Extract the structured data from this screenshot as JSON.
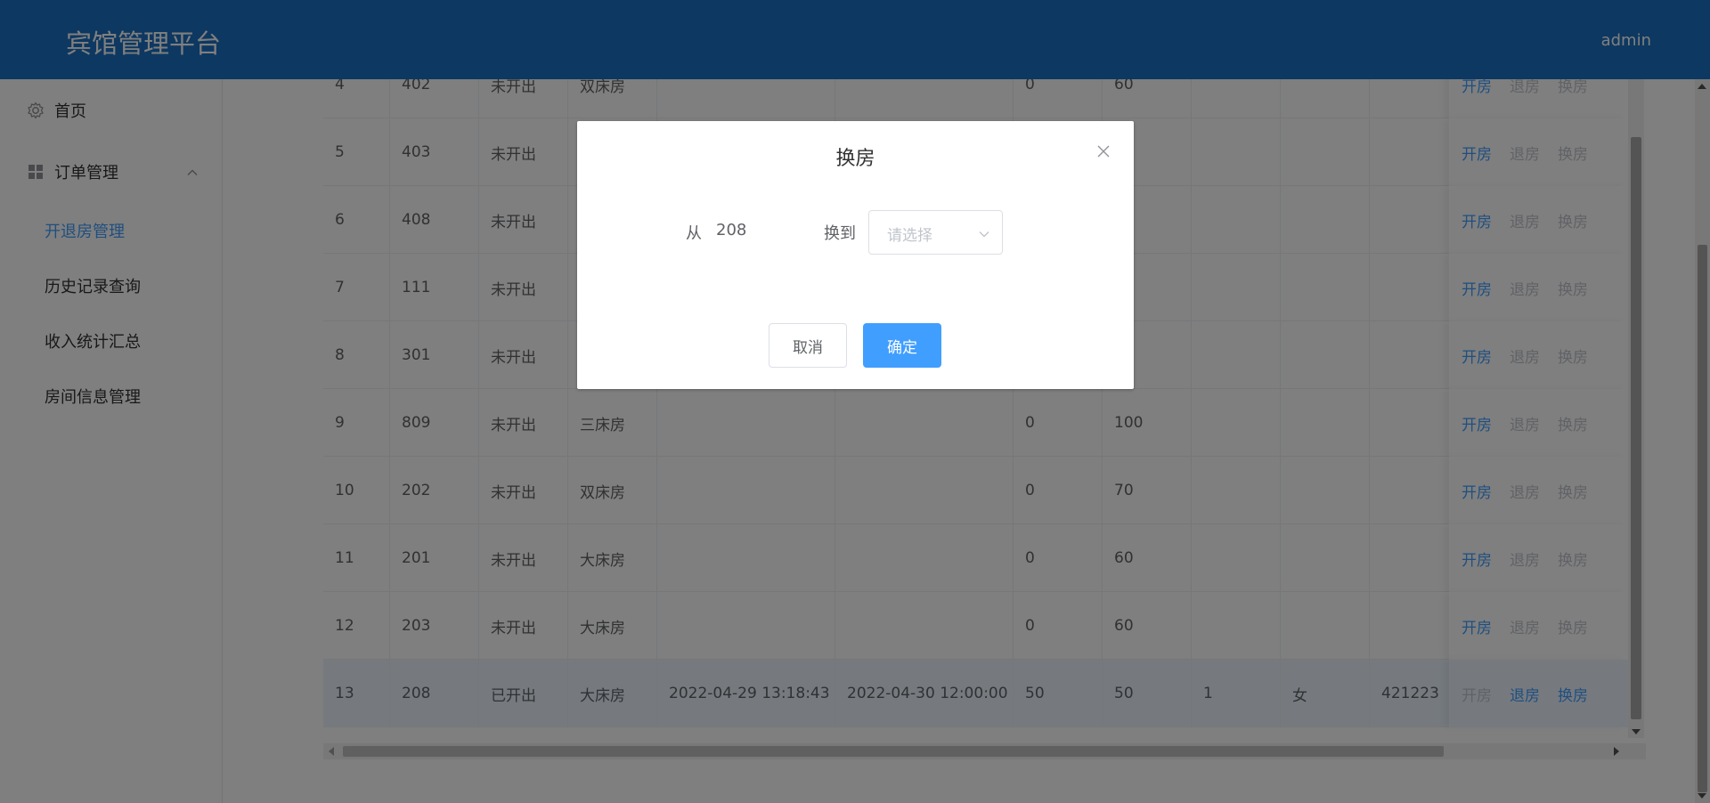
{
  "app": {
    "title": "宾馆管理平台",
    "user": "admin"
  },
  "sidebar": {
    "home": "首页",
    "orders": "订单管理",
    "sub": [
      "开退房管理",
      "历史记录查询",
      "收入统计汇总",
      "房间信息管理"
    ]
  },
  "table": {
    "rows": [
      {
        "idx": "4",
        "room": "402",
        "status": "未开出",
        "type": "双床房",
        "checkin": "",
        "checkout": "",
        "deposit": "0",
        "price": "60",
        "guests": "",
        "gender": "",
        "id": "",
        "ops": [
          "开房",
          "退房",
          "换房"
        ]
      },
      {
        "idx": "5",
        "room": "403",
        "status": "未开出",
        "type": "",
        "checkin": "",
        "checkout": "",
        "deposit": "",
        "price": "",
        "guests": "",
        "gender": "",
        "id": "",
        "ops": [
          "开房",
          "退房",
          "换房"
        ]
      },
      {
        "idx": "6",
        "room": "408",
        "status": "未开出",
        "type": "",
        "checkin": "",
        "checkout": "",
        "deposit": "",
        "price": "",
        "guests": "",
        "gender": "",
        "id": "",
        "ops": [
          "开房",
          "退房",
          "换房"
        ]
      },
      {
        "idx": "7",
        "room": "111",
        "status": "未开出",
        "type": "",
        "checkin": "",
        "checkout": "",
        "deposit": "",
        "price": "",
        "guests": "",
        "gender": "",
        "id": "",
        "ops": [
          "开房",
          "退房",
          "换房"
        ]
      },
      {
        "idx": "8",
        "room": "301",
        "status": "未开出",
        "type": "",
        "checkin": "",
        "checkout": "",
        "deposit": "",
        "price": "",
        "guests": "",
        "gender": "",
        "id": "",
        "ops": [
          "开房",
          "退房",
          "换房"
        ]
      },
      {
        "idx": "9",
        "room": "809",
        "status": "未开出",
        "type": "三床房",
        "checkin": "",
        "checkout": "",
        "deposit": "0",
        "price": "100",
        "guests": "",
        "gender": "",
        "id": "",
        "ops": [
          "开房",
          "退房",
          "换房"
        ]
      },
      {
        "idx": "10",
        "room": "202",
        "status": "未开出",
        "type": "双床房",
        "checkin": "",
        "checkout": "",
        "deposit": "0",
        "price": "70",
        "guests": "",
        "gender": "",
        "id": "",
        "ops": [
          "开房",
          "退房",
          "换房"
        ]
      },
      {
        "idx": "11",
        "room": "201",
        "status": "未开出",
        "type": "大床房",
        "checkin": "",
        "checkout": "",
        "deposit": "0",
        "price": "60",
        "guests": "",
        "gender": "",
        "id": "",
        "ops": [
          "开房",
          "退房",
          "换房"
        ]
      },
      {
        "idx": "12",
        "room": "203",
        "status": "未开出",
        "type": "大床房",
        "checkin": "",
        "checkout": "",
        "deposit": "0",
        "price": "60",
        "guests": "",
        "gender": "",
        "id": "",
        "ops": [
          "开房",
          "退房",
          "换房"
        ]
      },
      {
        "idx": "13",
        "room": "208",
        "status": "已开出",
        "type": "大床房",
        "checkin": "2022-04-29 13:18:43",
        "checkout": "2022-04-30 12:00:00",
        "deposit": "50",
        "price": "50",
        "guests": "1",
        "gender": "女",
        "id": "421223",
        "ops": [
          "开房",
          "退房",
          "换房"
        ]
      }
    ]
  },
  "dialog": {
    "title": "换房",
    "from_label": "从",
    "from_value": "208",
    "to_label": "换到",
    "select_placeholder": "请选择",
    "cancel": "取消",
    "confirm": "确定"
  },
  "colors": {
    "header": "#1a70c2",
    "accent": "#409eff"
  }
}
